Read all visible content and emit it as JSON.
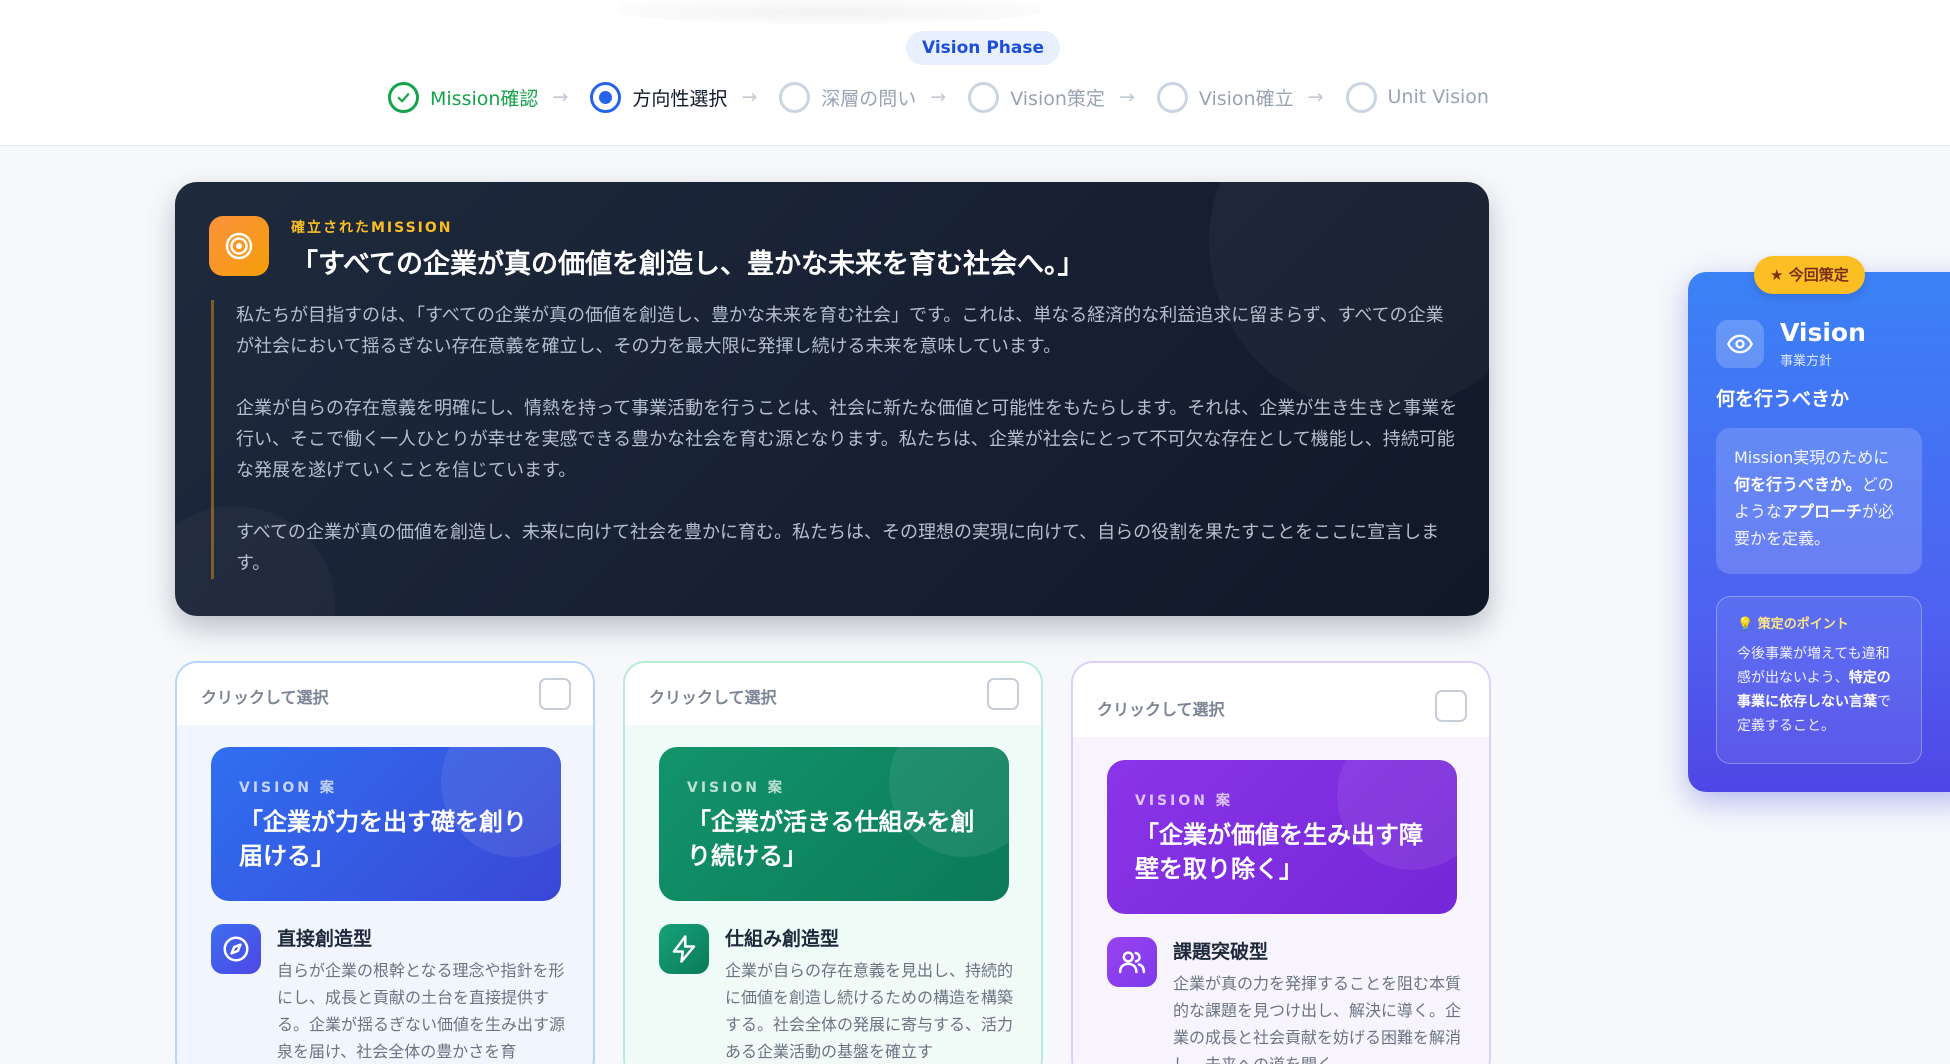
{
  "header": {
    "phase_badge": "Vision Phase",
    "steps": [
      {
        "label": "Mission確認",
        "state": "done"
      },
      {
        "label": "方向性選択",
        "state": "active"
      },
      {
        "label": "深層の問い",
        "state": "pending"
      },
      {
        "label": "Vision策定",
        "state": "pending"
      },
      {
        "label": "Vision確立",
        "state": "pending"
      },
      {
        "label": "Unit Vision",
        "state": "pending"
      }
    ]
  },
  "mission": {
    "kicker": "確立されたMISSION",
    "title": "「すべての企業が真の価値を創造し、豊かな未来を育む社会へ。」",
    "paragraphs": [
      "私たちが目指すのは、「すべての企業が真の価値を創造し、豊かな未来を育む社会」です。これは、単なる経済的な利益追求に留まらず、すべての企業が社会において揺るぎない存在意義を確立し、その力を最大限に発揮し続ける未来を意味しています。",
      "企業が自らの存在意義を明確にし、情熱を持って事業活動を行うことは、社会に新たな価値と可能性をもたらします。それは、企業が生き生きと事業を行い、そこで働く一人ひとりが幸せを実感できる豊かな社会を育む源となります。私たちは、企業が社会にとって不可欠な存在として機能し、持続可能な発展を遂げていくことを信じています。",
      "すべての企業が真の価値を創造し、未来に向けて社会を豊かに育む。私たちは、その理想の実現に向けて、自らの役割を果たすことをここに宣言します。"
    ]
  },
  "options": [
    {
      "hint": "クリックして選択",
      "kicker": "VISION 案",
      "title": "「企業が力を出す礎を創り届ける」",
      "name": "直接創造型",
      "desc": "自らが企業の根幹となる理念や指針を形にし、成長と貢献の土台を直接提供する。企業が揺るぎない価値を生み出す源泉を届け、社会全体の豊かさを育"
    },
    {
      "hint": "クリックして選択",
      "kicker": "VISION 案",
      "title": "「企業が活きる仕組みを創り続ける」",
      "name": "仕組み創造型",
      "desc": "企業が自らの存在意義を見出し、持続的に価値を創造し続けるための構造を構築する。社会全体の発展に寄与する、活力ある企業活動の基盤を確立す"
    },
    {
      "hint": "クリックして選択",
      "kicker": "VISION 案",
      "title": "「企業が価値を生み出す障壁を取り除く」",
      "name": "課題突破型",
      "desc": "企業が真の力を発揮することを阻む本質的な課題を見つけ出し、解決に導く。企業の成長と社会貢献を妨げる困難を解消し、未来への道を開く。"
    }
  ],
  "vision_panel": {
    "badge": "今回策定",
    "title": "Vision",
    "subtitle": "事業方針",
    "question": "何を行うべきか",
    "box1_a": "Mission実現のために",
    "box1_b": "何を行うべきか。",
    "box1_c": "どのような",
    "box1_d": "アプローチ",
    "box1_e": "が必要かを定義。",
    "box2_head": "策定のポイント",
    "box2_a": "今後事業が増えても違和感が出ないよう、",
    "box2_b": "特定の事業に依存しない言葉",
    "box2_c": "で定義すること。"
  },
  "colors": {
    "accent_blue": "#2563eb",
    "done_green": "#16a34a",
    "mission_bg": "#1f2a3d",
    "mission_kicker": "#fbbf24",
    "badge_yellow": "#fbbf24"
  }
}
